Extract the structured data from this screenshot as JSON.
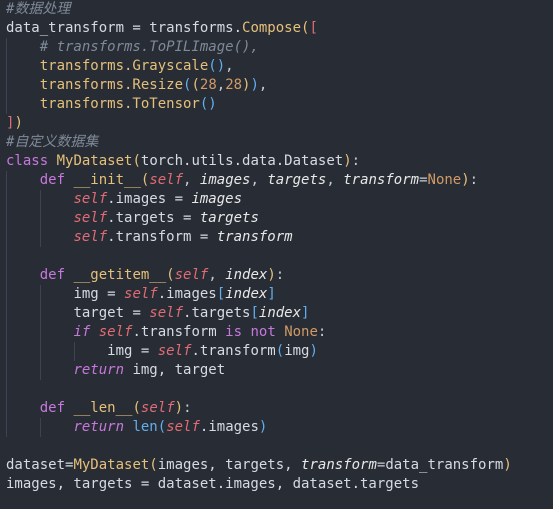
{
  "editor": {
    "lines": [
      "#数据处理",
      "data_transform = transforms.Compose([",
      "    # transforms.ToPILImage(),",
      "    transforms.Grayscale(),",
      "    transforms.Resize((28,28)),",
      "    transforms.ToTensor()",
      "])",
      "#自定义数据集",
      "class MyDataset(torch.utils.data.Dataset):",
      "    def __init__(self, images, targets, transform=None):",
      "        self.images = images",
      "        self.targets = targets",
      "        self.transform = transform",
      "",
      "    def __getitem__(self, index):",
      "        img = self.images[index]",
      "        target = self.targets[index]",
      "        if self.transform is not None:",
      "            img = self.transform(img)",
      "        return img, target",
      "",
      "    def __len__(self):",
      "        return len(self.images)",
      "",
      "dataset=MyDataset(images, targets, transform=data_transform)",
      "images, targets = dataset.images, dataset.targets"
    ],
    "colors": {
      "background": "#282c34",
      "keyword": "#c678dd",
      "class_name": "#e5c07b",
      "self": "#e06c75",
      "comment": "#7f8a99",
      "number": "#d19a66",
      "text": "#d6dbe3"
    }
  }
}
